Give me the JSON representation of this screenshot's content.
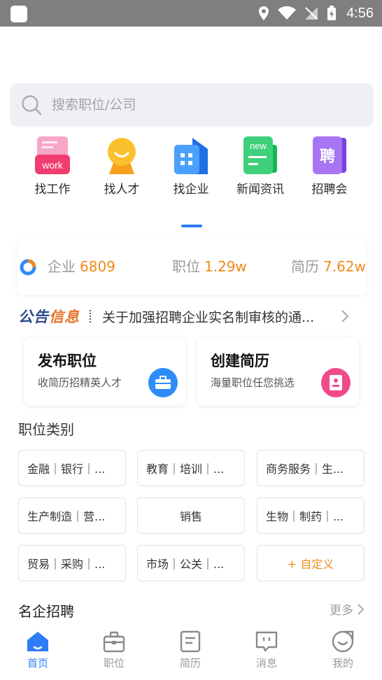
{
  "status_bar": {
    "time": "4:56"
  },
  "search": {
    "placeholder": "搜索职位/公司",
    "icon": "search-icon"
  },
  "quick_menu": [
    {
      "label": "找工作",
      "icon": "work-icon",
      "badge": "work"
    },
    {
      "label": "找人才",
      "icon": "talent-icon"
    },
    {
      "label": "找企业",
      "icon": "enterprise-icon"
    },
    {
      "label": "新闻资讯",
      "icon": "news-icon",
      "badge": "new"
    },
    {
      "label": "招聘会",
      "icon": "job-fair-icon",
      "badge": "聘"
    }
  ],
  "stats": [
    {
      "label": "企业",
      "value": "6809"
    },
    {
      "label": "职位",
      "value": "1.29w"
    },
    {
      "label": "简历",
      "value": "7.62w"
    }
  ],
  "notice": {
    "logo_part1": "公告",
    "logo_part2": "信息",
    "text": "关于加强招聘企业实名制审核的通..."
  },
  "cards": [
    {
      "title": "发布职位",
      "subtitle": "收简历招精英人才",
      "icon": "briefcase-icon",
      "color": "#2f8cf6"
    },
    {
      "title": "创建简历",
      "subtitle": "海量职位任您挑选",
      "icon": "resume-icon",
      "color": "#f04a8a"
    }
  ],
  "job_categories": {
    "title": "职位类别",
    "items": [
      "金融｜银行｜...",
      "教育｜培训｜...",
      "商务服务｜生...",
      "生产制造｜营...",
      "销售",
      "生物｜制药｜...",
      "贸易｜采购｜...",
      "市场｜公关｜...",
      "+ 自定义"
    ]
  },
  "famous": {
    "title": "名企招聘",
    "more": "更多"
  },
  "tabbar": [
    {
      "label": "首页",
      "icon": "home-icon",
      "active": true
    },
    {
      "label": "职位",
      "icon": "briefcase-icon"
    },
    {
      "label": "简历",
      "icon": "document-icon"
    },
    {
      "label": "消息",
      "icon": "message-icon"
    },
    {
      "label": "我的",
      "icon": "profile-icon"
    }
  ],
  "colors": {
    "accent": "#2f7cf6",
    "number": "#f08a1c"
  }
}
